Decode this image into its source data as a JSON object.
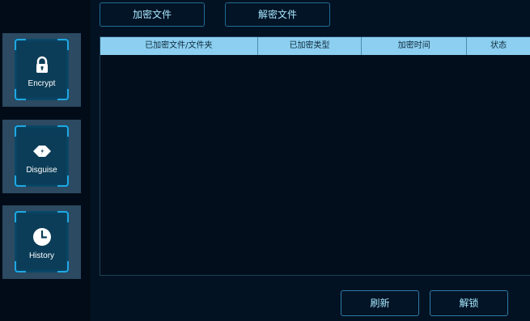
{
  "nav": {
    "encrypt_label": "Encrypt",
    "disguise_label": "Disguise",
    "history_label": "History"
  },
  "toolbar": {
    "encrypt_file_label": "加密文件",
    "decrypt_file_label": "解密文件"
  },
  "table": {
    "columns": [
      "已加密文件/文件夹",
      "已加密类型",
      "加密时间",
      "状态"
    ],
    "rows": []
  },
  "footer": {
    "refresh_label": "刷新",
    "unlock_label": "解锁"
  },
  "colors": {
    "background": "#020e1c",
    "accent": "#1ea8e4",
    "header": "#8ccff0",
    "tile": "#2c4a61"
  },
  "icons": [
    "lock-icon",
    "disguise-icon",
    "clock-icon"
  ]
}
